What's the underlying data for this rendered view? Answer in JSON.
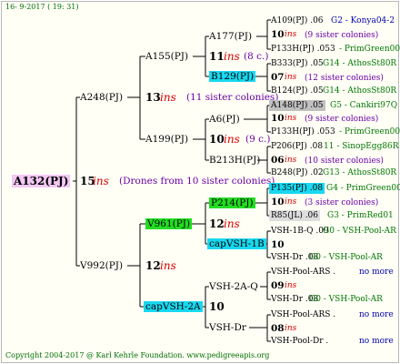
{
  "header_date": "16-  9-2017 ( 19: 31)",
  "root": {
    "name": "A132(PJ)",
    "num": "15",
    "ins": "ins",
    "note": "(Drones from 10 sister colonies)"
  },
  "g1": [
    {
      "name": "A248(PJ)",
      "num": "13",
      "ins": "ins",
      "note": "(11 sister colonies)"
    },
    {
      "name": "V992(PJ)",
      "num": "12",
      "ins": "ins",
      "note": ""
    }
  ],
  "g2": [
    {
      "name": "A155(PJ)",
      "num": "11",
      "ins": "ins",
      "note": "(8 c.)"
    },
    {
      "name": "A199(PJ)",
      "num": "10",
      "ins": "ins",
      "note": "(9 c.)"
    },
    {
      "name": "V961(PJ)",
      "num": "12",
      "ins": "ins",
      "note": ""
    },
    {
      "name": "capVSH-2A",
      "num": "10",
      "ins": "",
      "note": ""
    }
  ],
  "g3": [
    {
      "name": "A177(PJ)",
      "num": "10",
      "ins": "ins",
      "note": "(9 sister colonies)"
    },
    {
      "name": "B129(PJ)",
      "num": "07",
      "ins": "ins",
      "note": "(12 sister colonies)"
    },
    {
      "name": "A6(PJ)",
      "num": "10",
      "ins": "ins",
      "note": "(9 sister colonies)"
    },
    {
      "name": "B213H(PJ)",
      "num": "06",
      "ins": "ins",
      "note": "(10 sister colonies)"
    },
    {
      "name": "P214(PJ)",
      "num": "10",
      "ins": "ins",
      "note": "(3 sister colonies)"
    },
    {
      "name": "capVSH-1B",
      "num": "10",
      "ins": "",
      "note": ""
    },
    {
      "name": "VSH-2A-Q",
      "num": "09",
      "ins": "ins",
      "note": ""
    },
    {
      "name": "VSH-Dr",
      "num": "08",
      "ins": "ins",
      "note": ""
    }
  ],
  "g4": [
    {
      "left": "A109(PJ) .06",
      "right": "G2 - Konya04-2"
    },
    {
      "left": "P133H(PJ) .053",
      "right": "- PrimGreen00"
    },
    {
      "left": "B333(PJ) .05",
      "right": "G14 - AthosSt80R"
    },
    {
      "left": "B124(PJ) .05",
      "right": "G14 - AthosSt80R"
    },
    {
      "left": "A148(PJ) .05",
      "right": "G5 - Cankiri97Q"
    },
    {
      "left": "P133H(PJ) .053",
      "right": "- PrimGreen00"
    },
    {
      "left": "P206(PJ) .08",
      "right": "11 - SinopEgg86R"
    },
    {
      "left": "B248(PJ) .02",
      "right": "G13 - AthosSt80R"
    },
    {
      "left": "P135(PJ) .08",
      "right": "G4 - PrimGreen00"
    },
    {
      "left": "R85(JL) .06",
      "right": "G3 - PrimRed01"
    },
    {
      "left": "VSH-1B-Q .09",
      "right": "G0 - VSH-Pool-AR"
    },
    {
      "left": "VSH-Dr .08",
      "right": "G0 - VSH-Pool-AR"
    },
    {
      "left": "VSH-Pool-ARS .",
      "right": "no more"
    },
    {
      "left": "VSH-Dr .08",
      "right": "G0 - VSH-Pool-AR"
    },
    {
      "left": "VSH-Pool-ARS .",
      "right": "no more"
    },
    {
      "left": "VSH-Pool-Dr .",
      "right": "no more"
    }
  ],
  "footer": "Copyright 2004-2017 @ Karl Kehrle Foundation.   www.pedigreeapis.org"
}
